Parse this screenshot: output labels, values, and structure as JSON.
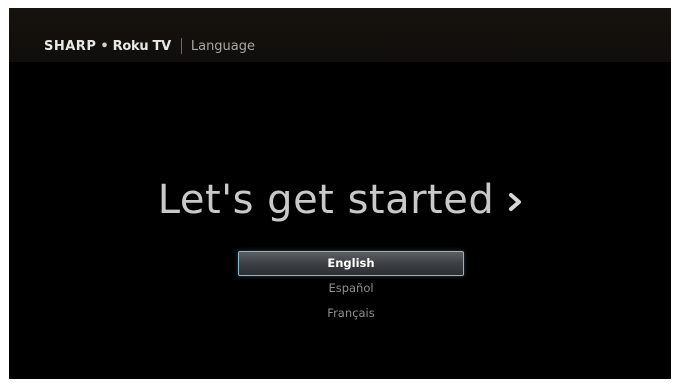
{
  "header": {
    "brand_sharp": "SHARP",
    "brand_separator_dot": "•",
    "brand_roku": "Roku TV",
    "page_title": "Language"
  },
  "main": {
    "headline": "Let's get started",
    "languages": [
      {
        "label": "English",
        "selected": true
      },
      {
        "label": "Español",
        "selected": false
      },
      {
        "label": "Français",
        "selected": false
      }
    ]
  },
  "colors": {
    "background": "#000000",
    "selection_border": "#86b9c6",
    "text_inactive": "#8f8f8f",
    "headline": "#c9c9c9"
  },
  "icons": {
    "next": "chevron-right-icon"
  }
}
